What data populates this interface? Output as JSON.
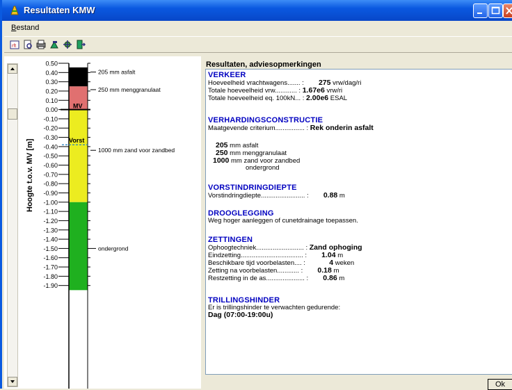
{
  "window": {
    "title": "Resultaten KMW"
  },
  "menu": {
    "items": [
      "Bestand"
    ]
  },
  "toolbar": {
    "icons": [
      "report-icon",
      "print-preview-icon",
      "print-icon",
      "tool-icon",
      "settings-icon",
      "exit-icon"
    ]
  },
  "chart_data": {
    "type": "bar",
    "ylabel": "Hoogte t.o.v. MV [m]",
    "ylim": [
      -1.95,
      0.5
    ],
    "ticks": [
      "0.50",
      "0.40",
      "0.30",
      "0.20",
      "0.10",
      "0.00",
      "-0.10",
      "-0.20",
      "-0.30",
      "-0.40",
      "-0.50",
      "-0.60",
      "-0.70",
      "-0.80",
      "-0.90",
      "-1.00",
      "-1.10",
      "-1.20",
      "-1.30",
      "-1.40",
      "-1.50",
      "-1.60",
      "-1.70",
      "-1.80",
      "-1.90"
    ],
    "tick_values": [
      0.5,
      0.4,
      0.3,
      0.2,
      0.1,
      0.0,
      -0.1,
      -0.2,
      -0.3,
      -0.4,
      -0.5,
      -0.6,
      -0.7,
      -0.8,
      -0.9,
      -1.0,
      -1.1,
      -1.2,
      -1.3,
      -1.4,
      -1.5,
      -1.6,
      -1.7,
      -1.8,
      -1.9
    ],
    "layers": [
      {
        "name": "205 mm asfalt",
        "top": 0.455,
        "bottom": 0.25,
        "color": "#000000"
      },
      {
        "name": "250 mm menggranulaat",
        "top": 0.25,
        "bottom": 0.0,
        "color": "#e07070"
      },
      {
        "name": "1000 mm zand voor zandbed",
        "top": 0.0,
        "bottom": -1.0,
        "color": "#ecec20"
      },
      {
        "name": "ondergrond",
        "top": -1.0,
        "bottom": -1.95,
        "color": "#1fb01f"
      }
    ],
    "markers": [
      {
        "label": "MV",
        "value": 0.0
      },
      {
        "label": "Vorst",
        "value": -0.38
      }
    ],
    "label_positions": [
      0.405,
      0.215,
      -0.44,
      -1.5
    ]
  },
  "results": {
    "title": "Resultaten, adviesopmerkingen",
    "sections": [
      {
        "heading": "VERKEER",
        "lines": [
          {
            "label": "Hoeveelheid vrachtwagens....... :",
            "value": "275",
            "unit": "vrw/dag/ri"
          },
          {
            "label": "Totale hoeveelheid vrw............ :",
            "value": "1.67e6",
            "unit": "vrw/ri"
          },
          {
            "label": "Totale hoeveelheid eq. 100kN... :",
            "value": "2.00e6",
            "unit": "ESAL"
          }
        ]
      },
      {
        "heading": "VERHARDINGSCONSTRUCTIE",
        "lines": [
          {
            "label": "Maatgevende criterium................ :",
            "value": "Rek onderin asfalt",
            "unit": ""
          }
        ]
      },
      {
        "heading": "VORSTINDRINGDIEPTE",
        "lines": [
          {
            "label": "Vorstindringdiepte........................ :",
            "value": "0.88",
            "unit": "m"
          }
        ]
      },
      {
        "heading": "DROOGLEGGING",
        "lines": [
          {
            "label": "Weg hoger aanleggen of cunetdrainage toepassen.",
            "value": "",
            "unit": ""
          }
        ]
      },
      {
        "heading": "ZETTINGEN",
        "lines": [
          {
            "label": "Ophoogtechniek.......................... :",
            "value": "Zand ophoging",
            "unit": ""
          },
          {
            "label": "Eindzetting.................................. :",
            "value": "1.04",
            "unit": "m"
          },
          {
            "label": "Beschikbare tijd voorbelasten.... :",
            "value": "4",
            "unit": "weken"
          },
          {
            "label": "Zetting na voorbelasten............ :",
            "value": "0.18",
            "unit": "m"
          },
          {
            "label": "Restzetting in de as..................... :",
            "value": "0.86",
            "unit": "m"
          }
        ]
      },
      {
        "heading": "TRILLINGSHINDER",
        "lines": [
          {
            "label": "Er is trillingshinder te verwachten gedurende:",
            "value": "",
            "unit": ""
          },
          {
            "label": "",
            "value": "Dag (07:00-19:00u)",
            "unit": ""
          }
        ]
      }
    ],
    "construction": [
      {
        "value": "205",
        "text": "mm asfalt"
      },
      {
        "value": "250",
        "text": "mm menggranulaat"
      },
      {
        "value": "1000",
        "text": "mm zand voor zandbed"
      },
      {
        "value": "",
        "text": "ondergrond"
      }
    ]
  },
  "buttons": {
    "ok": "Ok"
  }
}
